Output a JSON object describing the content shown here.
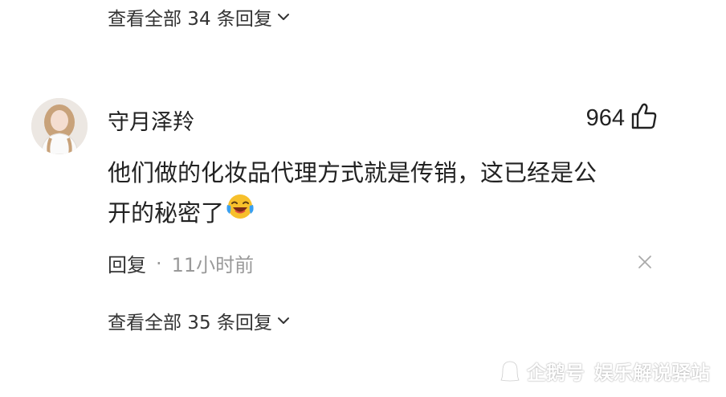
{
  "replies_top": {
    "label": "查看全部 34 条回复"
  },
  "comment": {
    "username": "守月泽羚",
    "likes": "964",
    "text_line1": "他们做的化妆品代理方式就是传销，这已经是公",
    "text_line2": "开的秘密了",
    "emoji": "crying-laughing-emoji",
    "reply_label": "回复",
    "separator": "·",
    "time": "11小时前"
  },
  "replies_bottom": {
    "label": "查看全部 35 条回复"
  },
  "watermark": {
    "brand": "企鹅号",
    "account": "娱乐解说驿站"
  },
  "colors": {
    "text": "#222222",
    "muted": "#999999",
    "emoji_yellow": "#f7c02b",
    "tear_blue": "#3aa0f0"
  }
}
